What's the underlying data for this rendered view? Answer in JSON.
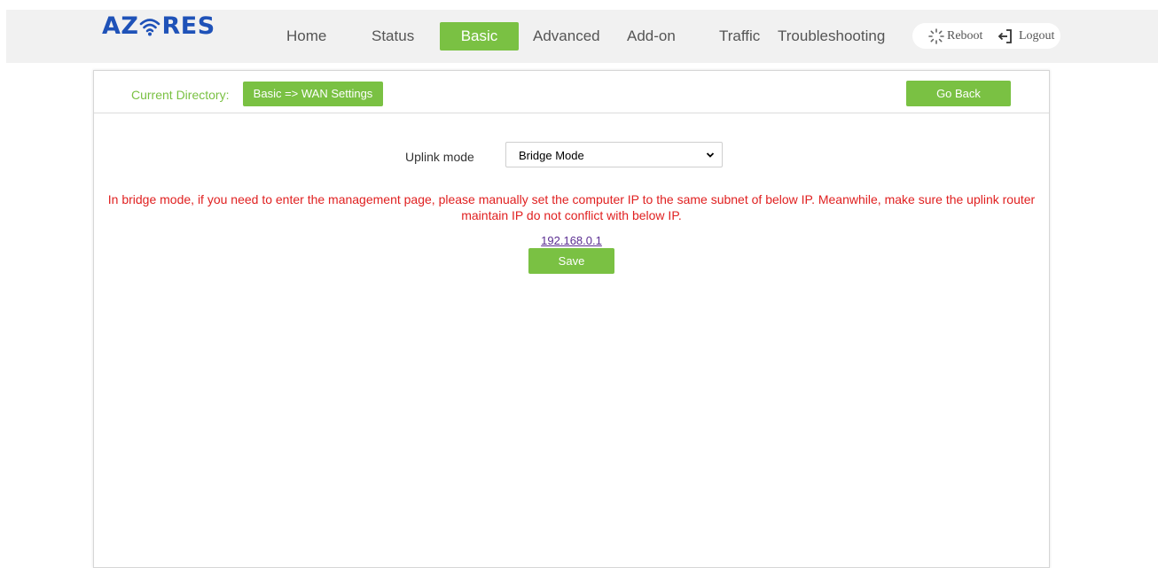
{
  "brand": {
    "logo_left": "AZ",
    "logo_right": "RES",
    "logo_color": "#1f52b8"
  },
  "nav": {
    "items": [
      {
        "label": "Home"
      },
      {
        "label": "Status"
      },
      {
        "label": "Basic",
        "active": true
      },
      {
        "label": "Advanced"
      },
      {
        "label": "Add-on"
      },
      {
        "label": "Traffic"
      },
      {
        "label": "Troubleshooting"
      }
    ],
    "reboot_label": "Reboot",
    "logout_label": "Logout",
    "reboot_icon": "spinner-icon",
    "logout_icon": "logout-arrow-icon"
  },
  "breadcrumb": {
    "label": "Current Directory:",
    "value": "Basic => WAN Settings"
  },
  "go_back_label": "Go Back",
  "form": {
    "uplink_label": "Uplink mode",
    "uplink_value": "Bridge Mode",
    "warning": "In bridge mode, if you need to enter the management page, please manually set the computer IP to the same subnet of below IP. Meanwhile, make sure the uplink router maintain IP do not conflict with below IP.",
    "ip": "192.168.0.1",
    "save_label": "Save"
  },
  "colors": {
    "accent": "#7ac143",
    "warning": "#e02020",
    "link": "#5a2d91"
  }
}
